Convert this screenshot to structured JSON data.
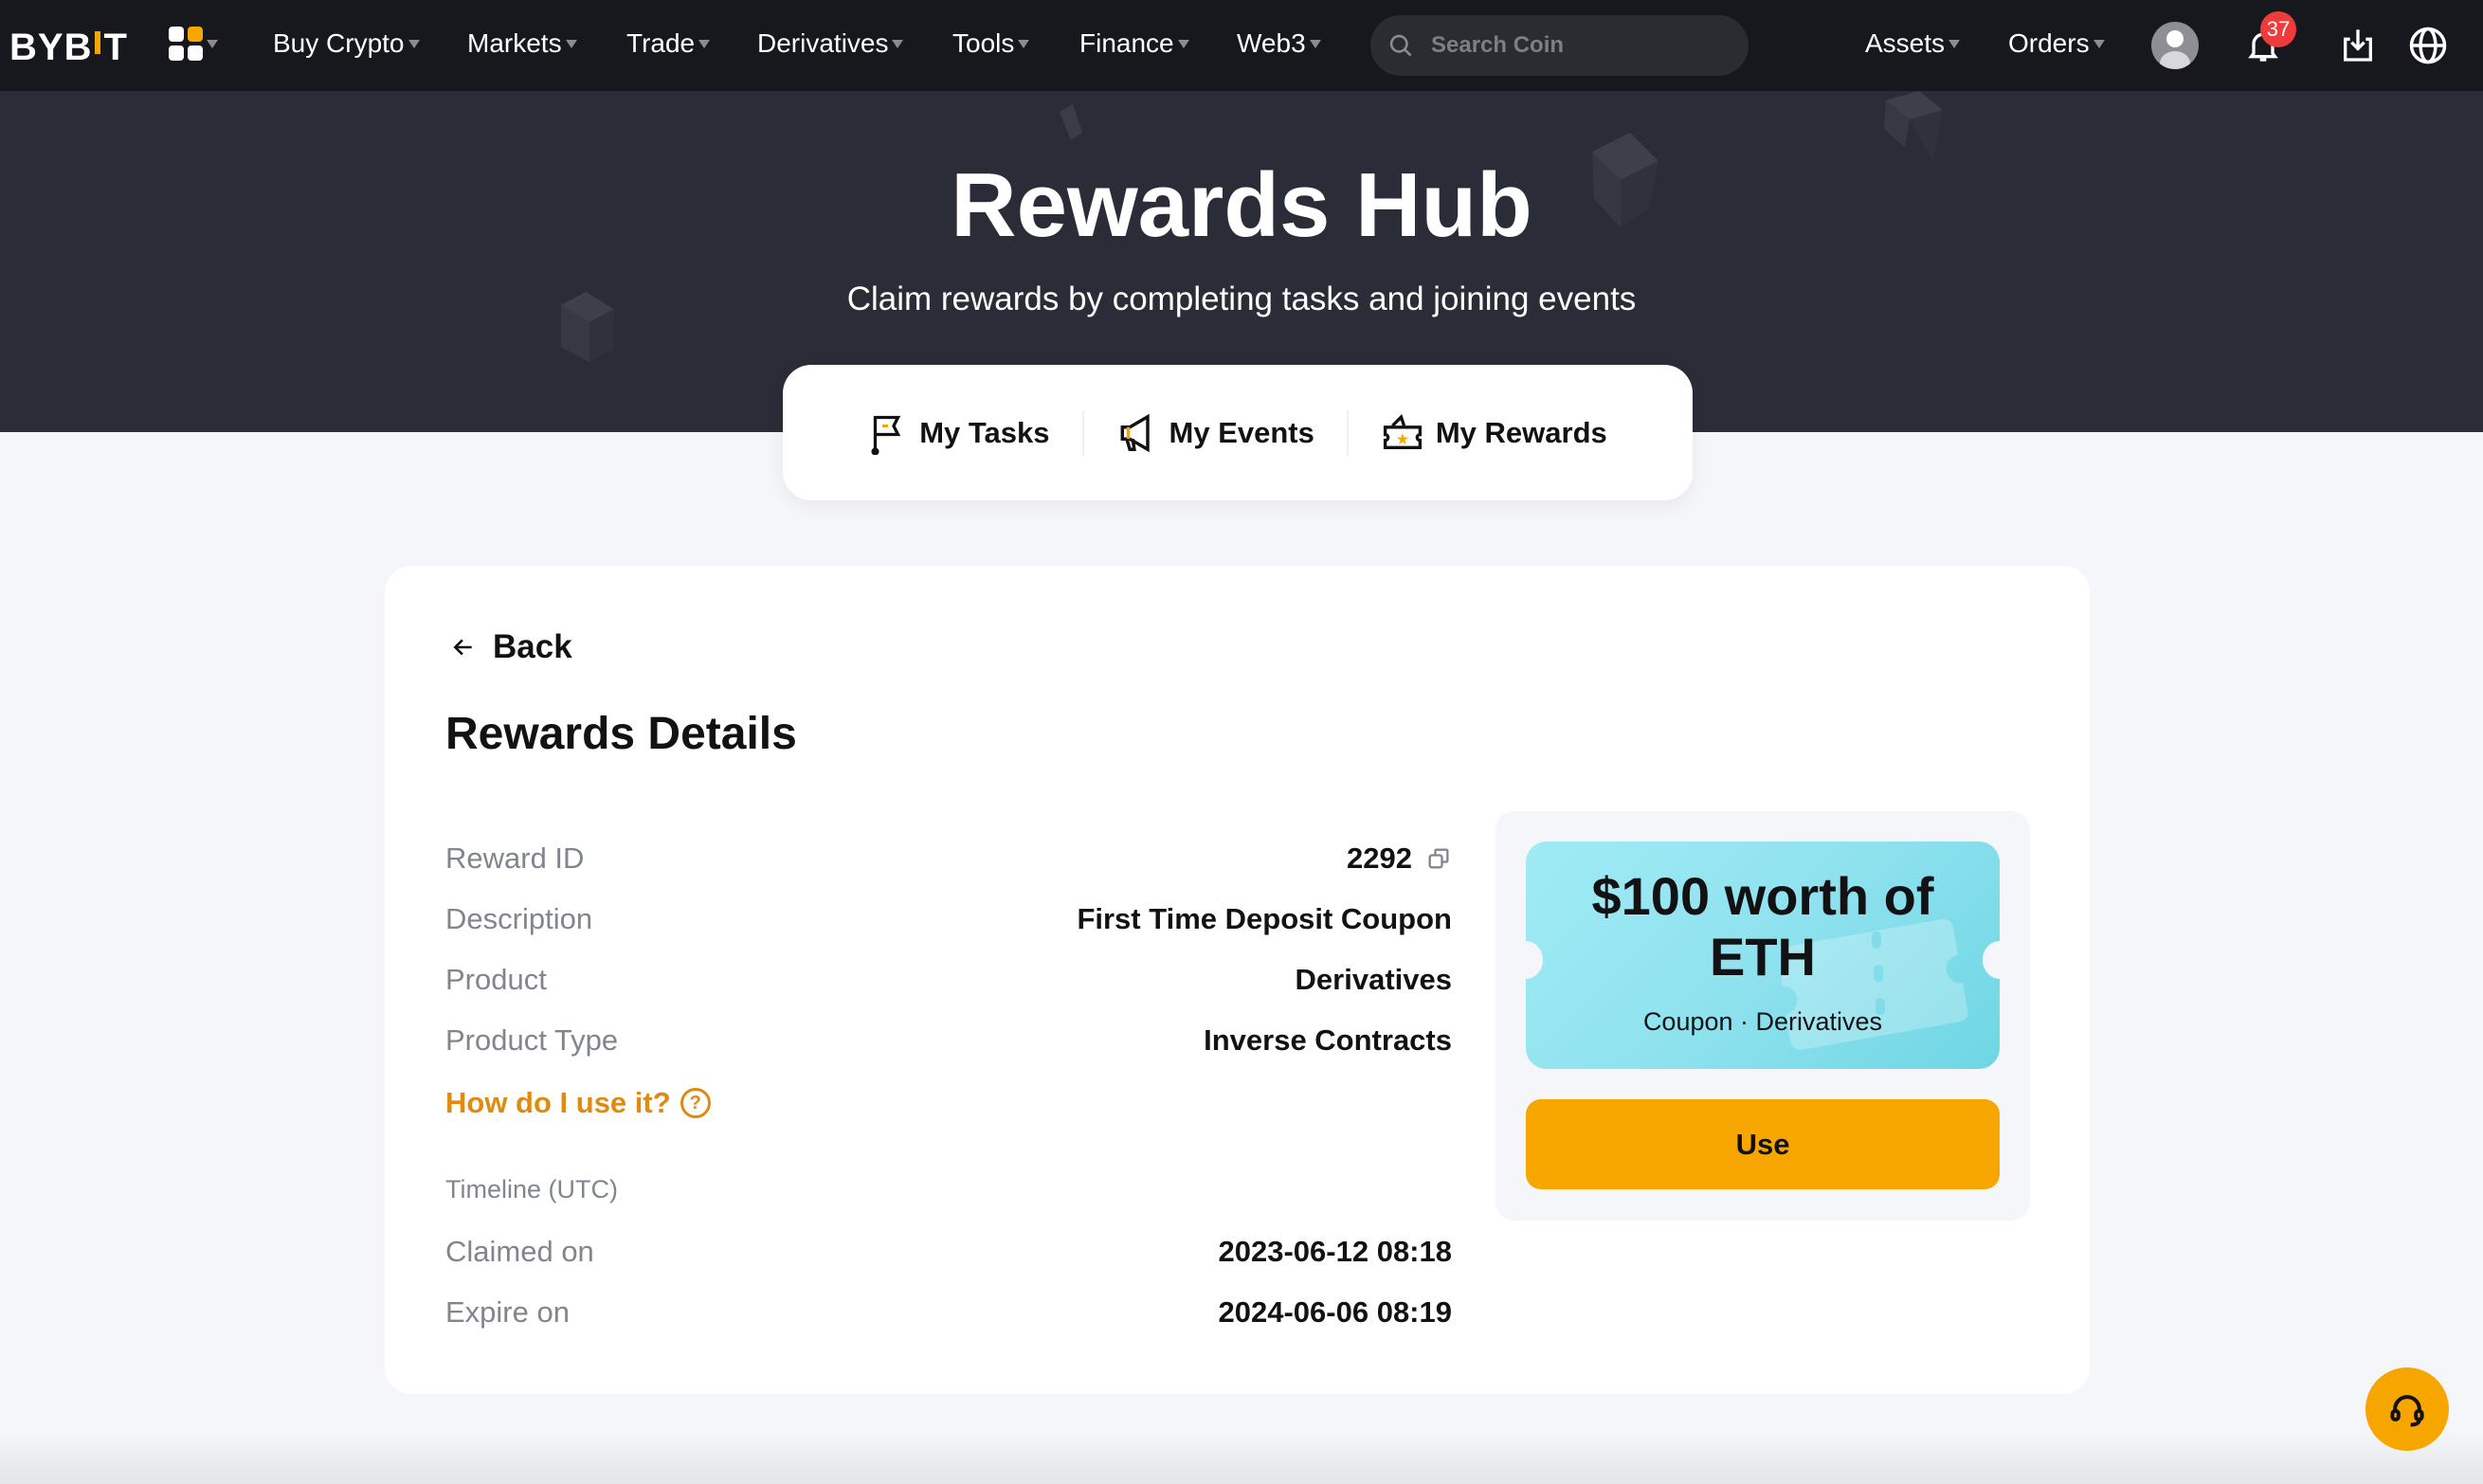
{
  "nav": {
    "logo": "BYBIT",
    "items": [
      {
        "label": "Buy Crypto"
      },
      {
        "label": "Markets"
      },
      {
        "label": "Trade"
      },
      {
        "label": "Derivatives"
      },
      {
        "label": "Tools"
      },
      {
        "label": "Finance"
      },
      {
        "label": "Web3"
      }
    ],
    "search_placeholder": "Search Coin",
    "right_items": [
      {
        "label": "Assets"
      },
      {
        "label": "Orders"
      }
    ],
    "notification_count": "37",
    "icons": [
      "apps-grid-icon",
      "search-icon",
      "avatar",
      "bell-icon",
      "download-icon",
      "globe-icon"
    ]
  },
  "hero": {
    "title": "Rewards Hub",
    "subtitle": "Claim rewards by completing tasks and joining events"
  },
  "tabs": [
    {
      "label": "My Tasks",
      "icon": "flag-icon"
    },
    {
      "label": "My Events",
      "icon": "megaphone-icon"
    },
    {
      "label": "My Rewards",
      "icon": "ticket-icon"
    }
  ],
  "details": {
    "back_label": "Back",
    "title": "Rewards Details",
    "rows": [
      {
        "key": "Reward ID",
        "value": "2292"
      },
      {
        "key": "Description",
        "value": "First Time Deposit Coupon"
      },
      {
        "key": "Product",
        "value": "Derivatives"
      },
      {
        "key": "Product Type",
        "value": "Inverse Contracts"
      }
    ],
    "howto_label": "How do I use it?",
    "timeline_label": "Timeline (UTC)",
    "timeline": [
      {
        "key": "Claimed on",
        "value": "2023-06-12 08:18"
      },
      {
        "key": "Expire on",
        "value": "2024-06-06 08:19"
      }
    ]
  },
  "coupon": {
    "amount_line1": "$100 worth of",
    "amount_line2": "ETH",
    "meta": "Coupon · Derivatives",
    "use_label": "Use"
  },
  "colors": {
    "accent": "#f7a600",
    "link": "#e08b10",
    "nav_bg": "#17181e",
    "hero_bg": "#2a2d37",
    "badge": "#ef3b3b",
    "ticket": "#8ee2ee"
  }
}
